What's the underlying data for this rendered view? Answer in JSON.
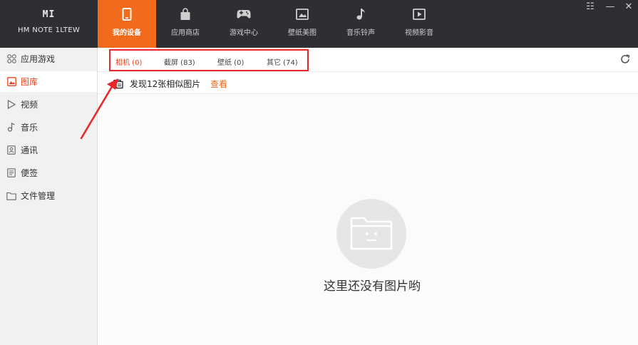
{
  "device": {
    "logo": "MI",
    "model": "HM NOTE 1LTEW"
  },
  "nav": {
    "tabs": [
      {
        "label": "我的设备",
        "icon": "phone-icon",
        "active": true
      },
      {
        "label": "应用商店",
        "icon": "bag-icon",
        "active": false
      },
      {
        "label": "游戏中心",
        "icon": "gamepad-icon",
        "active": false
      },
      {
        "label": "壁纸美图",
        "icon": "wallpaper-icon",
        "active": false
      },
      {
        "label": "音乐铃声",
        "icon": "music-note-icon",
        "active": false
      },
      {
        "label": "视频影音",
        "icon": "video-play-icon",
        "active": false
      }
    ]
  },
  "window_controls": {
    "menu": "☷",
    "minimize": "—",
    "close": "✕"
  },
  "sidebar": {
    "items": [
      {
        "label": "应用游戏",
        "icon": "apps-icon"
      },
      {
        "label": "图库",
        "icon": "gallery-icon",
        "active": true
      },
      {
        "label": "视频",
        "icon": "play-icon"
      },
      {
        "label": "音乐",
        "icon": "music-icon"
      },
      {
        "label": "通讯",
        "icon": "contacts-icon"
      },
      {
        "label": "便签",
        "icon": "notes-icon"
      },
      {
        "label": "文件管理",
        "icon": "folder-icon"
      }
    ]
  },
  "gallery": {
    "tabs": [
      {
        "label": "相机 (0)",
        "active": true
      },
      {
        "label": "截屏 (83)"
      },
      {
        "label": "壁纸 (0)"
      },
      {
        "label": "其它 (74)"
      }
    ],
    "notice": {
      "text": "发现12张相似图片",
      "link": "查看"
    },
    "empty_text": "这里还没有图片哟"
  },
  "colors": {
    "accent": "#f26b1d",
    "topbar": "#2d2f33",
    "highlight_box": "#e8282b",
    "active_sidebar_text": "#e8431c"
  }
}
